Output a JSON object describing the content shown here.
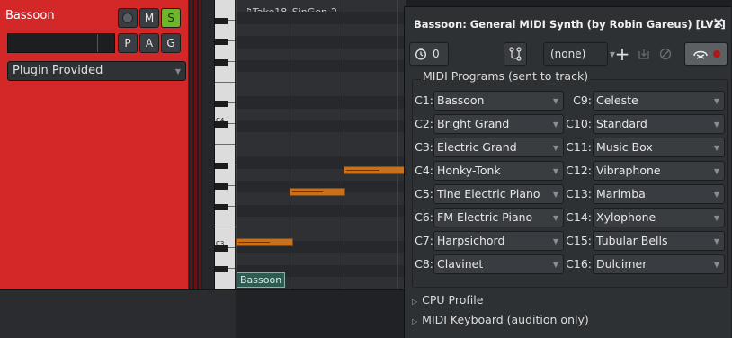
{
  "track": {
    "name": "Bassoon",
    "mute_label": "M",
    "solo_label": "S",
    "playlist_label": "P",
    "automation_label": "A",
    "group_label": "G",
    "automation_select": "Plugin Provided"
  },
  "editor": {
    "region_name": "♫Take18_SinGen-2",
    "region_label": "Bassoon",
    "octave_labels": [
      "C4",
      "C3"
    ]
  },
  "plugin": {
    "title": "Bassoon: General MIDI Synth (by Robin Gareus) [LV2]",
    "close_icon": "✕",
    "latency_value": "0",
    "preset_value": "(none)",
    "programs_title": "MIDI Programs (sent to track)",
    "programs_left": [
      {
        "channel": "C1:",
        "program": "Bassoon"
      },
      {
        "channel": "C2:",
        "program": "Bright Grand"
      },
      {
        "channel": "C3:",
        "program": "Electric Grand"
      },
      {
        "channel": "C4:",
        "program": "Honky-Tonk"
      },
      {
        "channel": "C5:",
        "program": "Tine Electric Piano"
      },
      {
        "channel": "C6:",
        "program": "FM Electric Piano"
      },
      {
        "channel": "C7:",
        "program": "Harpsichord"
      },
      {
        "channel": "C8:",
        "program": "Clavinet"
      }
    ],
    "programs_right": [
      {
        "channel": "C9:",
        "program": "Celeste"
      },
      {
        "channel": "C10:",
        "program": "Standard"
      },
      {
        "channel": "C11:",
        "program": "Music Box"
      },
      {
        "channel": "C12:",
        "program": "Vibraphone"
      },
      {
        "channel": "C13:",
        "program": "Marimba"
      },
      {
        "channel": "C14:",
        "program": "Xylophone"
      },
      {
        "channel": "C15:",
        "program": "Tubular Bells"
      },
      {
        "channel": "C16:",
        "program": "Dulcimer"
      }
    ],
    "cpu_profile_label": "CPU Profile",
    "midi_keyboard_label": "MIDI Keyboard (audition only)"
  },
  "colors": {
    "track_header": "#d42727",
    "solo_active": "#6fb52c",
    "note": "#c9701c",
    "region_label_bg": "#2f5c52",
    "bypass_led": "#b01818"
  },
  "icons": {
    "record_arm": "record-circle-icon",
    "latency": "clock-icon",
    "routing": "routing-graph-icon",
    "add_preset": "plus-icon",
    "save_preset": "save-icon",
    "delete_preset": "no-entry-icon",
    "bypass": "power-bypass-icon",
    "expander": "triangle-right-icon"
  }
}
